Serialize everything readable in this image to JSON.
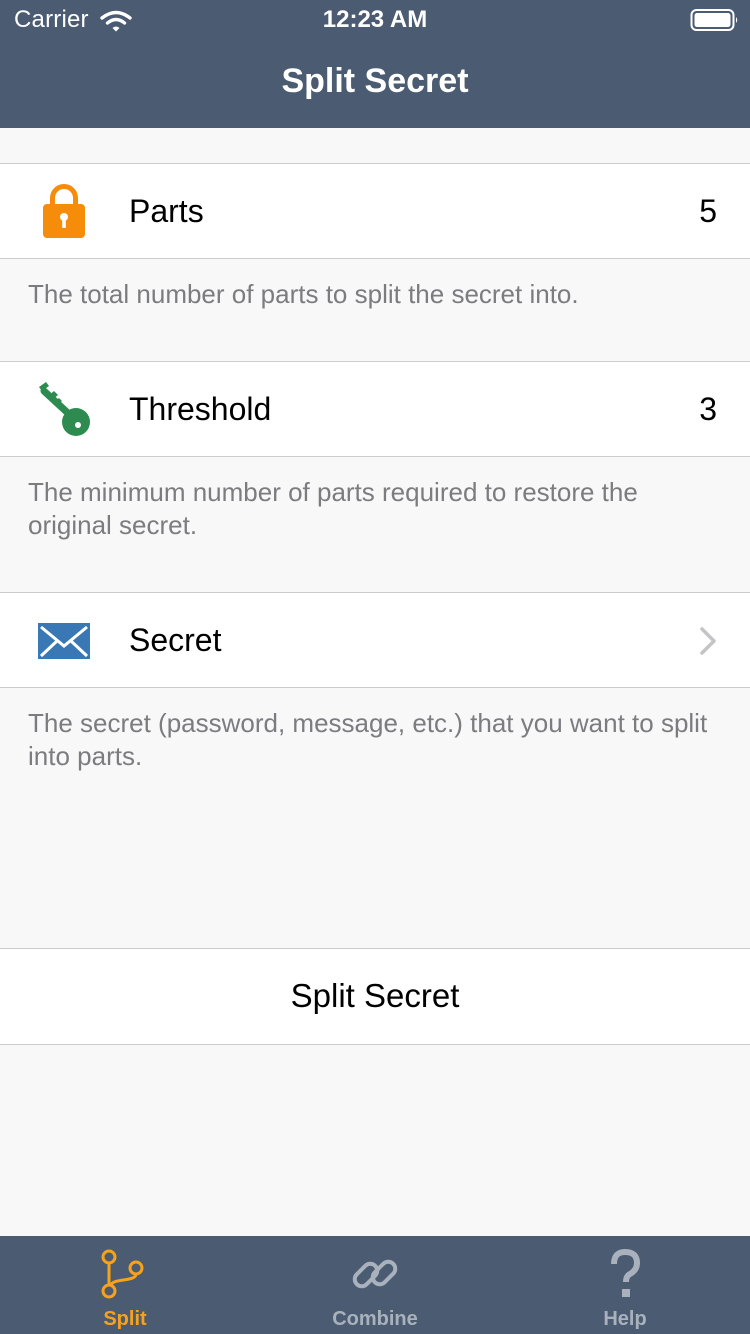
{
  "status_bar": {
    "carrier": "Carrier",
    "time": "12:23 AM"
  },
  "nav": {
    "title": "Split Secret"
  },
  "settings": [
    {
      "label": "Parts",
      "value": "5",
      "icon": "lock-icon",
      "footer": "The total number of parts to split the secret into."
    },
    {
      "label": "Threshold",
      "value": "3",
      "icon": "key-icon",
      "footer": "The minimum number of parts required to restore the original secret."
    },
    {
      "label": "Secret",
      "value": "",
      "icon": "envelope-icon",
      "footer": "The secret (password, message, etc.) that you want to split into parts."
    }
  ],
  "action": {
    "label": "Split Secret"
  },
  "tabs": [
    {
      "label": "Split",
      "icon": "branch-icon",
      "selected": true
    },
    {
      "label": "Combine",
      "icon": "link-icon",
      "selected": false
    },
    {
      "label": "Help",
      "icon": "question-icon",
      "selected": false
    }
  ],
  "colors": {
    "bar_background": "#4a5b72",
    "tab_selected": "#f7a21b",
    "tab_unselected": "#a9b1bc",
    "lock_orange": "#f58d0b",
    "key_green": "#2e8b50",
    "envelope_blue": "#3a78b5",
    "footer_text": "#7c7c80"
  }
}
